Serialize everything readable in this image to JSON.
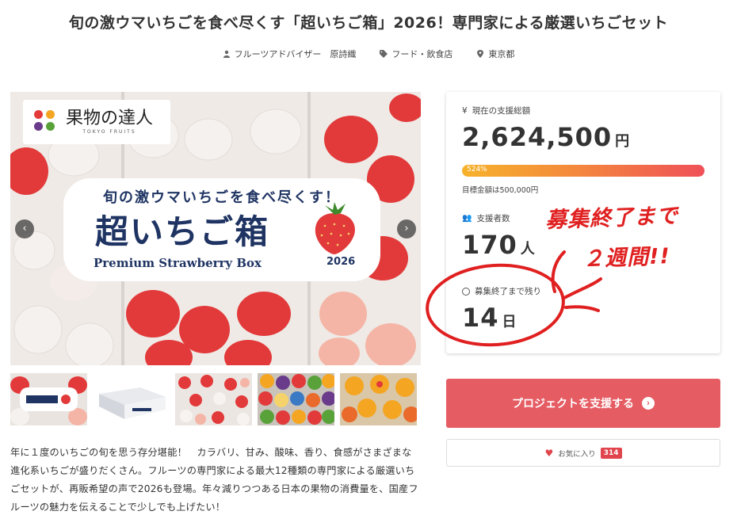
{
  "project": {
    "title": "旬の激ウマいちごを食べ尽くす「超いちご箱」2026！専門家による厳選いちごセット",
    "author": "フルーツアドバイザー　原詩織",
    "category": "フード・飲食店",
    "location": "東京都"
  },
  "hero": {
    "logo_main": "果物の達人",
    "logo_sub": "TOKYO FRUITS",
    "tagline": "旬の激ウマいちごを食べ尽くす！",
    "product_name": "超いちご箱",
    "product_sub": "Premium Strawberry Box",
    "year": "2026",
    "prev_icon": "chevron-left-icon",
    "next_icon": "chevron-right-icon"
  },
  "description": "年に１度のいちごの旬を思う存分堪能！　カラバリ、甘み、酸味、香り、食感がさまざまな進化系いちごが盛りだくさん。フルーツの専門家による最大12種類の専門家による厳選いちごセットが、再販希望の声で2026も登場。年々減りつつある日本の果物の消費量を、国産フルーツの魅力を伝えることで少しでも上げたい！",
  "stats": {
    "total_label": "現在の支援総額",
    "total_value": "2,624,500",
    "total_unit": "円",
    "progress_text": "524%",
    "progress_fraction": 1.0,
    "goal_text": "目標金額は500,000円",
    "supporters_label": "支援者数",
    "supporters_value": "170",
    "supporters_unit": "人",
    "remaining_label": "募集終了まで残り",
    "remaining_value": "14",
    "remaining_unit": "日"
  },
  "annotation": {
    "line1": "募集終了まで",
    "line2": "２週間!!",
    "color": "#e02020"
  },
  "actions": {
    "support_label": "プロジェクトを支援する",
    "favorite_label": "お気に入り",
    "favorite_count": "314"
  },
  "colors": {
    "accent": "#e55c63",
    "navy": "#1f3463"
  }
}
